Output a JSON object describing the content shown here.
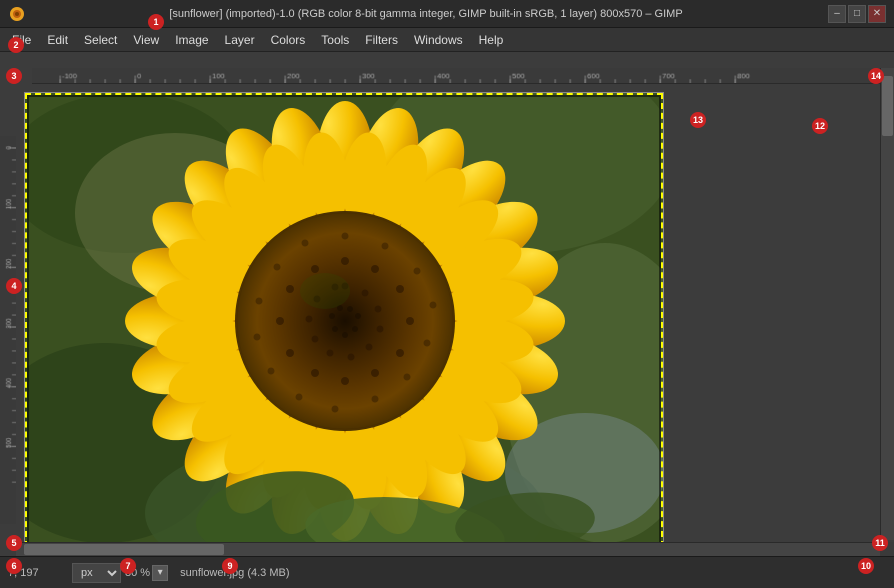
{
  "titlebar": {
    "title": "[sunflower] (imported)-1.0 (RGB color 8-bit gamma integer, GIMP built-in sRGB, 1 layer) 800x570 – GIMP",
    "icon": "gimp-icon",
    "controls": {
      "minimize": "–",
      "maximize": "□",
      "close": "✕"
    }
  },
  "menubar": {
    "items": [
      "File",
      "Edit",
      "Select",
      "View",
      "Image",
      "Layer",
      "Colors",
      "Tools",
      "Filters",
      "Windows",
      "Help"
    ]
  },
  "canvas": {
    "image_title": "sunflower",
    "selection_active": true
  },
  "statusbar": {
    "coords": "7, 197",
    "unit": "px",
    "zoom": "80 %",
    "filename": "sunflower.jpg (4.3 MB)"
  },
  "annotations": [
    {
      "id": "1",
      "label": "1"
    },
    {
      "id": "2",
      "label": "2"
    },
    {
      "id": "3",
      "label": "3"
    },
    {
      "id": "4",
      "label": "4"
    },
    {
      "id": "5",
      "label": "5"
    },
    {
      "id": "6",
      "label": "6"
    },
    {
      "id": "7",
      "label": "7"
    },
    {
      "id": "9",
      "label": "9"
    },
    {
      "id": "10",
      "label": "10"
    },
    {
      "id": "11",
      "label": "11"
    },
    {
      "id": "12",
      "label": "12"
    },
    {
      "id": "13",
      "label": "13"
    },
    {
      "id": "14",
      "label": "14"
    }
  ],
  "ruler": {
    "ticks_h": [
      "-100",
      "0",
      "100",
      "200",
      "300",
      "400",
      "500",
      "600",
      "700",
      "800"
    ],
    "ticks_v": [
      "0",
      "100",
      "200",
      "300",
      "400",
      "500"
    ]
  }
}
